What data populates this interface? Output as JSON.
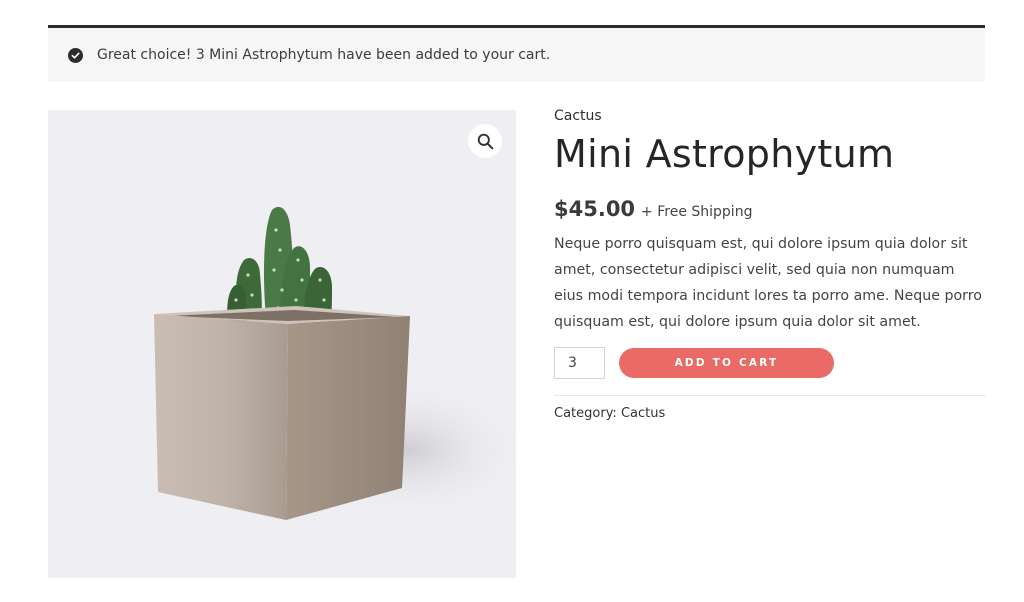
{
  "notice": {
    "message": "Great choice! 3 Mini Astrophytum have been added to your cart.",
    "icon": "check-circle-icon"
  },
  "gallery": {
    "zoom_icon": "magnifier-icon",
    "background": "#efeef2"
  },
  "product": {
    "category_link": "Cactus",
    "title": "Mini Astrophytum",
    "price": "$45.00",
    "shipping": "+ Free Shipping",
    "description": "Neque porro quisquam est, qui dolore ipsum quia dolor sit amet, consectetur adipisci velit, sed quia non numquam eius modi tempora incidunt lores ta porro ame. Neque porro quisquam est, qui dolore ipsum quia dolor sit amet.",
    "quantity": "3",
    "add_to_cart_label": "ADD TO CART",
    "meta_label": "Category:",
    "meta_value": "Cactus"
  },
  "colors": {
    "accent": "#ea6a66",
    "notice_border": "#2a2a2e",
    "notice_bg": "#f6f6f6"
  }
}
